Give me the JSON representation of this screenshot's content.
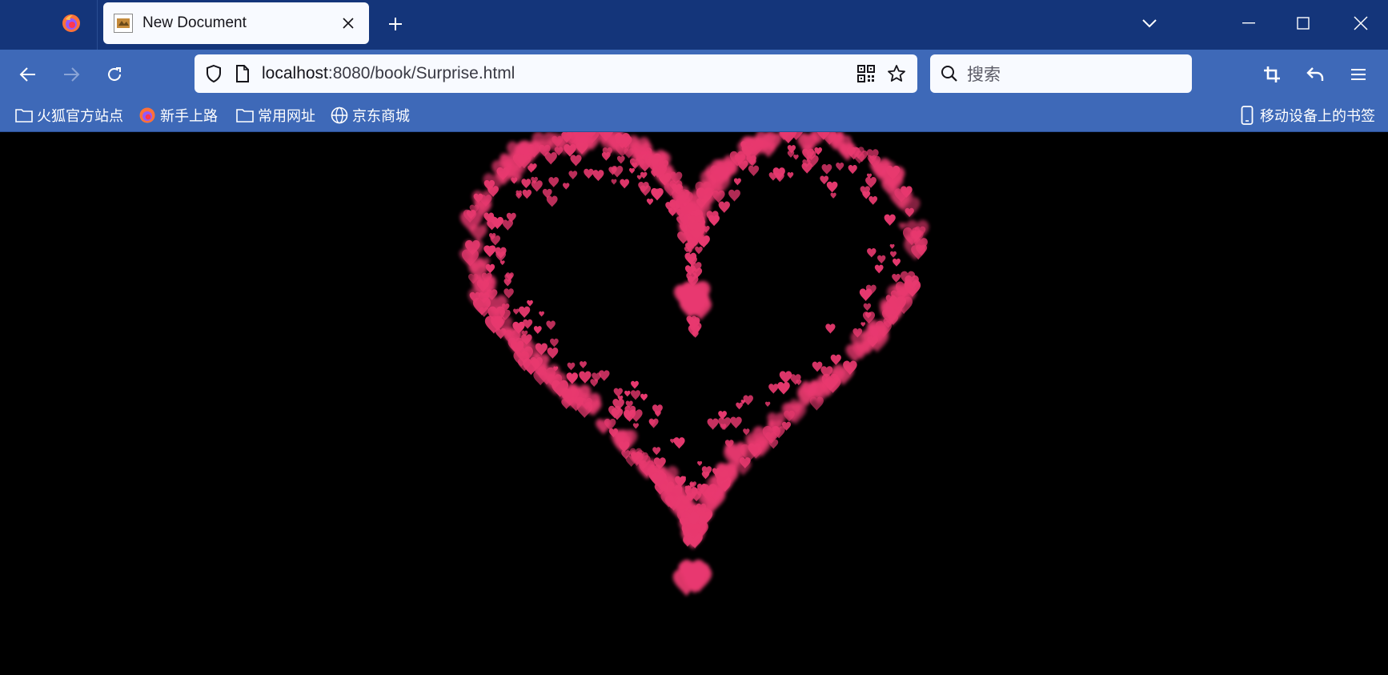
{
  "browser": {
    "tab": {
      "title": "New Document"
    },
    "url": {
      "host": "localhost",
      "path": ":8080/book/Surprise.html"
    },
    "search": {
      "placeholder": "搜索"
    },
    "bookmarks": [
      {
        "label": "火狐官方站点",
        "icon": "folder-icon"
      },
      {
        "label": "新手上路",
        "icon": "firefox-icon"
      },
      {
        "label": "常用网址",
        "icon": "folder-icon"
      },
      {
        "label": "京东商城",
        "icon": "globe-icon"
      }
    ],
    "mobile_bookmarks": {
      "label": "移动设备上的书签",
      "icon": "mobile-icon"
    },
    "colors": {
      "tabstrip": "#14357a",
      "toolbar": "#3e69b8",
      "heart": "#e8396f"
    }
  },
  "page": {
    "background": "#000000",
    "content": "heart made of small pink hearts"
  }
}
